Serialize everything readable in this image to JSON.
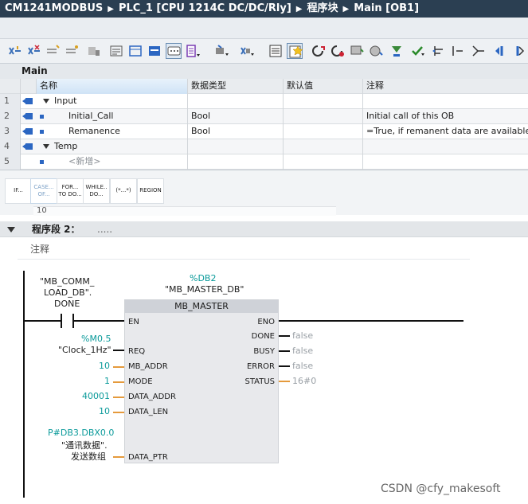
{
  "breadcrumb": [
    "CM1241MODBUS",
    "PLC_1 [CPU 1214C DC/DC/Rly]",
    "程序块",
    "Main [OB1]"
  ],
  "block": {
    "title": "Main"
  },
  "interface": {
    "headers": {
      "name": "名称",
      "type": "数据类型",
      "default": "默认值",
      "comment": "注释"
    },
    "rows": [
      {
        "num": "1",
        "name": "Input",
        "type": "",
        "comment": ""
      },
      {
        "num": "2",
        "name": "Initial_Call",
        "type": "Bool",
        "comment": "Initial call of this OB"
      },
      {
        "num": "3",
        "name": "Remanence",
        "type": "Bool",
        "comment": "=True, if remanent data are available"
      },
      {
        "num": "4",
        "name": "Temp",
        "type": "",
        "comment": ""
      },
      {
        "num": "5",
        "name": "<新增>",
        "type": "",
        "comment": ""
      }
    ]
  },
  "instructions": [
    {
      "line1": "IF...",
      "line2": ""
    },
    {
      "line1": "CASE...",
      "line2": "OF..."
    },
    {
      "line1": "FOR...",
      "line2": "TO DO..."
    },
    {
      "line1": "WHILE..",
      "line2": "DO..."
    },
    {
      "line1": "(*...*)",
      "line2": ""
    },
    {
      "line1": "REGION",
      "line2": ""
    }
  ],
  "scroll_fragment": "10",
  "network": {
    "title": "程序段 2：",
    "title_comment": ".....",
    "comment": "注释"
  },
  "ladder": {
    "contact_tag": [
      "\"MB_COMM_",
      "LOAD_DB\".",
      "DONE"
    ],
    "instance_db_addr": "%DB2",
    "instance_db_name": "\"MB_MASTER_DB\"",
    "fb_name": "MB_MASTER",
    "inputs": [
      {
        "pin": "EN",
        "value": "",
        "addr": ""
      },
      {
        "pin": "REQ",
        "value": "\"Clock_1Hz\"",
        "addr": "%M0.5"
      },
      {
        "pin": "MB_ADDR",
        "value": "10",
        "addr": ""
      },
      {
        "pin": "MODE",
        "value": "1",
        "addr": ""
      },
      {
        "pin": "DATA_ADDR",
        "value": "40001",
        "addr": ""
      },
      {
        "pin": "DATA_LEN",
        "value": "10",
        "addr": ""
      },
      {
        "pin": "DATA_PTR",
        "value": "",
        "addr": "P#DB3.DBX0.0",
        "tag1": "\"通讯数据\".",
        "tag2": "发送数组"
      }
    ],
    "outputs": [
      {
        "pin": "ENO",
        "value": ""
      },
      {
        "pin": "DONE",
        "value": "false"
      },
      {
        "pin": "BUSY",
        "value": "false"
      },
      {
        "pin": "ERROR",
        "value": "false"
      },
      {
        "pin": "STATUS",
        "value": "16#0"
      }
    ]
  },
  "watermark": "CSDN @cfy_makesoft",
  "colors": {
    "titlebar": "#2b3f52",
    "address_teal": "#0a9a9a",
    "wire_orange": "#e59a3c",
    "status_blue": "#2b66c2"
  }
}
